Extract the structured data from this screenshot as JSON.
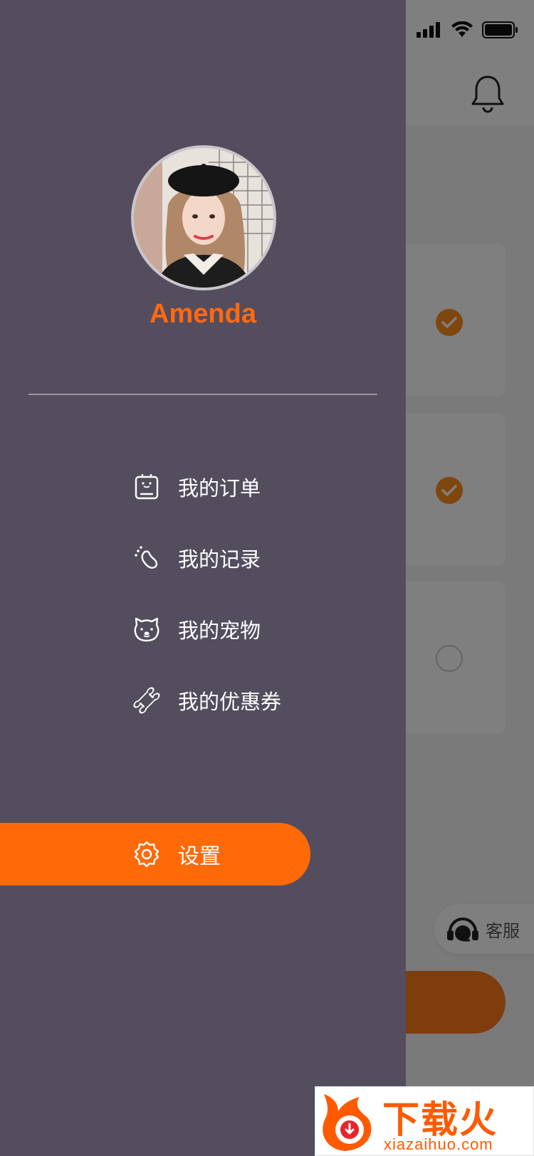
{
  "profile": {
    "username": "Amenda"
  },
  "menu": {
    "items": [
      {
        "label": "我的订单",
        "icon": "order-clipboard-icon"
      },
      {
        "label": "我的记录",
        "icon": "footprint-icon"
      },
      {
        "label": "我的宠物",
        "icon": "pet-face-icon"
      },
      {
        "label": "我的优惠券",
        "icon": "bone-coupon-icon"
      }
    ],
    "settings": {
      "label": "设置",
      "icon": "gear-icon"
    }
  },
  "background": {
    "customer_service_label": "客服"
  },
  "watermark": {
    "title": "下载火",
    "url": "xiazaihuo.com"
  },
  "colors": {
    "drawer_bg": "#544d5e",
    "accent": "#ff6a08",
    "username": "#ff6a10"
  }
}
